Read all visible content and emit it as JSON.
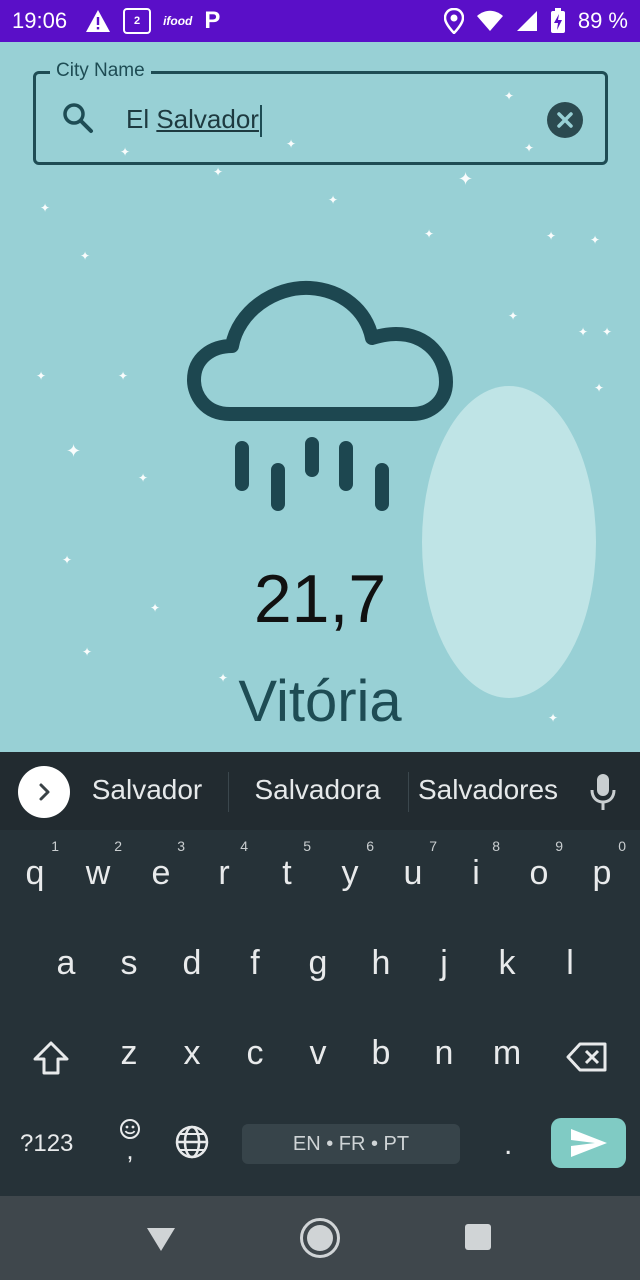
{
  "status_bar": {
    "time": "19:06",
    "battery": "89 %",
    "icons": [
      "warning-icon",
      "qr-app-icon",
      "ifood-icon",
      "p-app-icon",
      "location-icon",
      "wifi-icon",
      "signal-icon",
      "battery-charging-icon"
    ],
    "ifood_label": "ifood",
    "qr_badge": "2",
    "p_label": "P",
    "colors": {
      "background": "#5a0fc8"
    }
  },
  "search": {
    "label": "City Name",
    "value_plain": "El ",
    "value_underlined": "Salvador",
    "icon": "search-icon",
    "clear_icon": "clear-icon"
  },
  "weather": {
    "condition_icon": "rain-cloud-icon",
    "temperature": "21,7",
    "city": "Vitória"
  },
  "keyboard": {
    "suggestions": [
      "Salvador",
      "Salvadora",
      "Salvadores"
    ],
    "row1": [
      {
        "k": "q",
        "n": "1"
      },
      {
        "k": "w",
        "n": "2"
      },
      {
        "k": "e",
        "n": "3"
      },
      {
        "k": "r",
        "n": "4"
      },
      {
        "k": "t",
        "n": "5"
      },
      {
        "k": "y",
        "n": "6"
      },
      {
        "k": "u",
        "n": "7"
      },
      {
        "k": "i",
        "n": "8"
      },
      {
        "k": "o",
        "n": "9"
      },
      {
        "k": "p",
        "n": "0"
      }
    ],
    "row2": [
      "a",
      "s",
      "d",
      "f",
      "g",
      "h",
      "j",
      "k",
      "l"
    ],
    "row3": [
      "z",
      "x",
      "c",
      "v",
      "b",
      "n",
      "m"
    ],
    "symbols_label": "?123",
    "comma": ",",
    "period": ".",
    "space_label": "EN • FR • PT"
  },
  "colors": {
    "app_background": "#98d0d5",
    "accent_dark": "#1e4c54",
    "keyboard_background": "#263238",
    "send_button": "#80cbc4"
  }
}
